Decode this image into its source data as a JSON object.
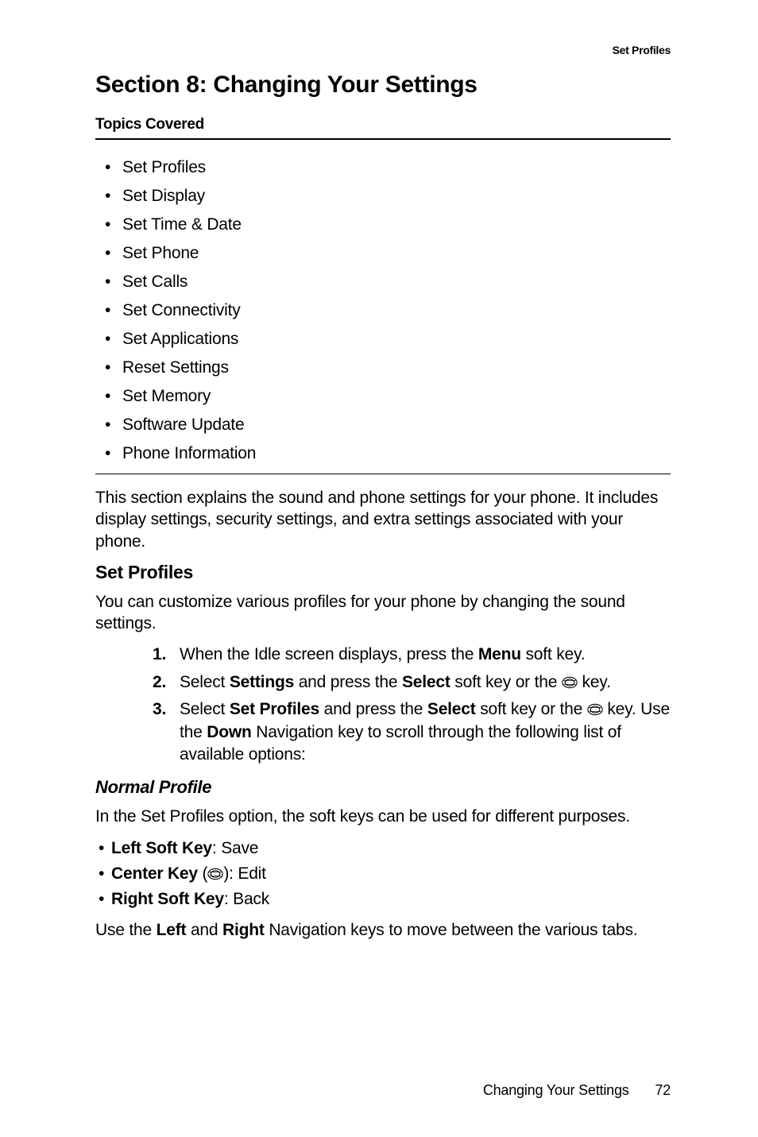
{
  "header": {
    "running_head": "Set Profiles"
  },
  "title": "Section 8: Changing Your Settings",
  "topics_label": "Topics Covered",
  "topics": [
    "Set Profiles",
    "Set Display",
    "Set Time & Date",
    "Set Phone",
    "Set Calls",
    "Set Connectivity",
    "Set Applications",
    "Reset Settings",
    "Set Memory",
    "Software Update",
    "Phone Information"
  ],
  "intro": "This section explains the sound and phone settings for your phone. It includes display settings, security settings, and extra settings associated with your phone.",
  "set_profiles": {
    "heading": "Set Profiles",
    "lead": "You can customize various profiles for your phone by changing the sound settings.",
    "steps": {
      "s1": {
        "pre": "When the Idle screen displays, press the ",
        "b1": "Menu",
        "post": " soft key."
      },
      "s2": {
        "pre": "Select ",
        "b1": "Settings",
        "mid": " and press the ",
        "b2": "Select",
        "post1": " soft key or the ",
        "post2": " key."
      },
      "s3": {
        "pre": "Select ",
        "b1": "Set Profiles",
        "mid": " and press the ",
        "b2": "Select",
        "post1": " soft key or the ",
        "post2": " key. Use the ",
        "b3": "Down",
        "tail": " Navigation key to scroll through the following list of available options:"
      }
    }
  },
  "normal_profile": {
    "heading": "Normal Profile",
    "lead": "In the Set Profiles option, the soft keys can be used for different purposes.",
    "keys": {
      "left": {
        "label": "Left Soft Key",
        "value": ": Save"
      },
      "center": {
        "label": "Center Key",
        "paren_open": " (",
        "paren_close": "): ",
        "value": "Edit"
      },
      "right": {
        "label": "Right Soft Key",
        "value": ": Back"
      }
    },
    "nav_sentence": {
      "pre": "Use the ",
      "b1": "Left",
      "mid": " and ",
      "b2": "Right",
      "post": " Navigation keys to move between the various tabs."
    }
  },
  "footer": {
    "chapter": "Changing Your Settings",
    "page": "72"
  }
}
